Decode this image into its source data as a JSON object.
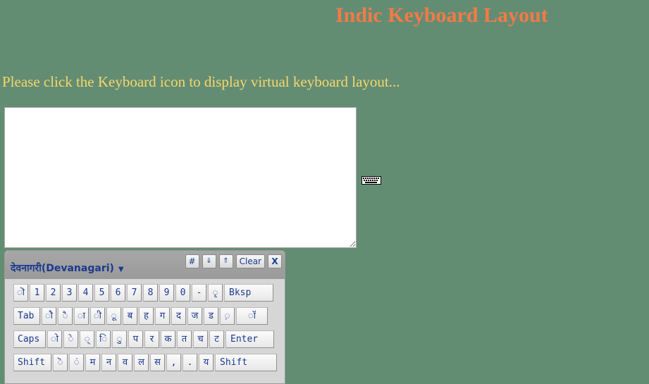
{
  "page": {
    "title": "Indic Keyboard Layout",
    "intro": "Please click the Keyboard icon to display virtual keyboard layout..."
  },
  "editor": {
    "value": ""
  },
  "keyboard_toggle": {
    "icon": "keyboard-icon"
  },
  "vk": {
    "language": "देवनागरी(Devanagari)",
    "controls": [
      "#",
      "⇓",
      "⇑",
      "Clear",
      "X"
    ],
    "rows": [
      [
        "ॊ",
        "1",
        "2",
        "3",
        "4",
        "5",
        "6",
        "7",
        "8",
        "9",
        "0",
        "-",
        "ृ",
        "Bksp"
      ],
      [
        "Tab",
        "ौ",
        "ै",
        "ा",
        "ी",
        "ू",
        "ब",
        "ह",
        "ग",
        "द",
        "ज",
        "ड",
        "़",
        "ॉ"
      ],
      [
        "Caps",
        "ो",
        "े",
        "्",
        "ि",
        "ु",
        "प",
        "र",
        "क",
        "त",
        "च",
        "ट",
        "Enter"
      ],
      [
        "Shift",
        "ॆ",
        "ं",
        "म",
        "न",
        "व",
        "ल",
        "स",
        ",",
        ".",
        "य",
        "Shift"
      ]
    ]
  },
  "colors": {
    "background": "#638d73",
    "title": "#f27a47",
    "intro": "#f5d76b",
    "key_text": "#1a3a8f"
  }
}
